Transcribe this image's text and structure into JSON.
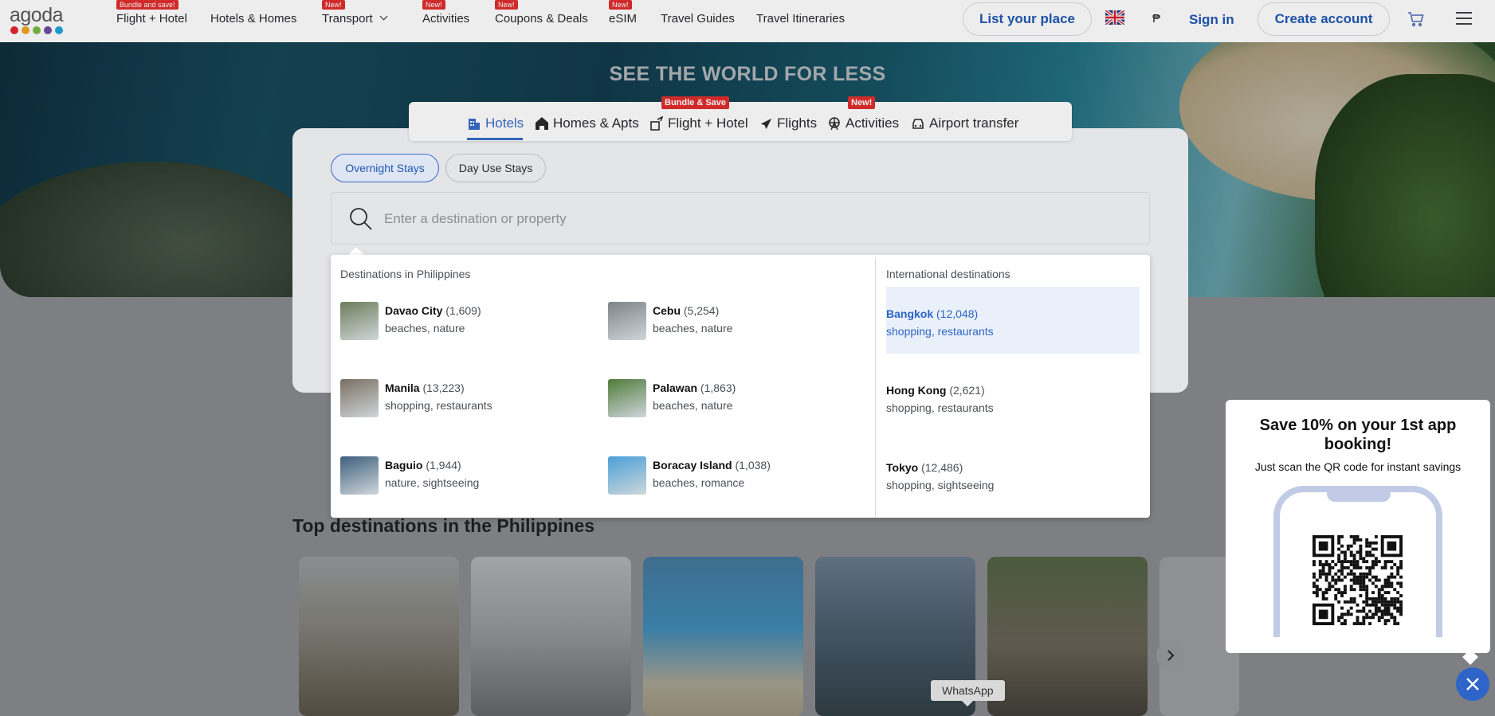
{
  "header": {
    "logo_text": "agoda",
    "logo_dot_colors": [
      "#e2262f",
      "#f3a321",
      "#7ab944",
      "#6f4ca0",
      "#1ea6d9"
    ],
    "nav": [
      {
        "label": "Flight + Hotel",
        "badge": "Bundle and save!"
      },
      {
        "label": "Hotels & Homes",
        "badge": ""
      },
      {
        "label": "Transport",
        "badge": "New!"
      },
      {
        "label": "Activities",
        "badge": "New!"
      },
      {
        "label": "Coupons & Deals",
        "badge": "New!"
      },
      {
        "label": "eSIM",
        "badge": "New!"
      },
      {
        "label": "Travel Guides",
        "badge": ""
      },
      {
        "label": "Travel Itineraries",
        "badge": ""
      }
    ],
    "list_place": "List your place",
    "currency_symbol": "₱",
    "sign_in": "Sign in",
    "create_account": "Create account"
  },
  "hero": {
    "title": "SEE THE WORLD FOR LESS"
  },
  "product_tabs": [
    {
      "label": "Hotels",
      "badge": "",
      "icon": "hotel-icon",
      "active": true
    },
    {
      "label": "Homes & Apts",
      "badge": "",
      "icon": "home-icon"
    },
    {
      "label": "Flight + Hotel",
      "badge": "Bundle & Save",
      "icon": "flight-hotel-icon"
    },
    {
      "label": "Flights",
      "badge": "",
      "icon": "plane-icon"
    },
    {
      "label": "Activities",
      "badge": "New!",
      "icon": "ferris-wheel-icon"
    },
    {
      "label": "Airport transfer",
      "badge": "",
      "icon": "car-icon"
    }
  ],
  "stay_types": {
    "overnight": "Overnight Stays",
    "day_use": "Day Use Stays"
  },
  "search": {
    "placeholder": "Enter a destination or property"
  },
  "dropdown": {
    "local_heading": "Destinations in Philippines",
    "intl_heading": "International destinations",
    "local": [
      {
        "name": "Davao City",
        "count": "(1,609)",
        "tags": "beaches, nature",
        "thumb": "#6c7d5a"
      },
      {
        "name": "Cebu",
        "count": "(5,254)",
        "tags": "beaches, nature",
        "thumb": "#7d8488"
      },
      {
        "name": "Manila",
        "count": "(13,223)",
        "tags": "shopping, restaurants",
        "thumb": "#7a6e63"
      },
      {
        "name": "Palawan",
        "count": "(1,863)",
        "tags": "beaches, nature",
        "thumb": "#4f7a3a"
      },
      {
        "name": "Baguio",
        "count": "(1,944)",
        "tags": "nature, sightseeing",
        "thumb": "#3e5f7d"
      },
      {
        "name": "Boracay Island",
        "count": "(1,038)",
        "tags": "beaches, romance",
        "thumb": "#4aa0d8"
      }
    ],
    "international": [
      {
        "name": "Bangkok",
        "count": "(12,048)",
        "tags": "shopping, restaurants"
      },
      {
        "name": "Hong Kong",
        "count": "(2,621)",
        "tags": "shopping, restaurants"
      },
      {
        "name": "Tokyo",
        "count": "(12,486)",
        "tags": "shopping, sightseeing"
      }
    ]
  },
  "section": {
    "title": "Top destinations in the Philippines"
  },
  "promo": {
    "title": "Save 10% on your 1st app booking!",
    "subtitle": "Just scan the QR code for instant savings"
  },
  "whatsapp_tooltip": "WhatsApp"
}
